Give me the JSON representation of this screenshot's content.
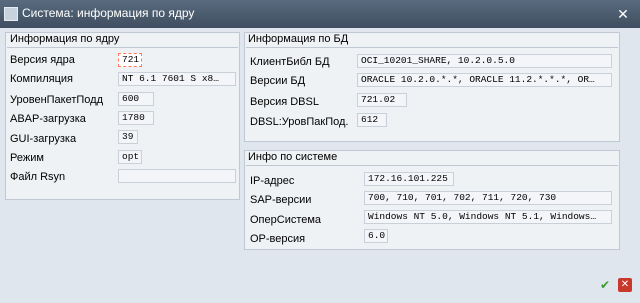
{
  "window": {
    "title": "Система: информация по ядру"
  },
  "kernel": {
    "title": "Информация по ядру",
    "rows": [
      {
        "label": "Версия ядра",
        "value": "721"
      },
      {
        "label": "Компиляция",
        "value": "NT 6.1 7601 S x8…"
      },
      {
        "label": "УровенПакетПодд",
        "value": "600"
      },
      {
        "label": "ABAP-загрузка",
        "value": "1780"
      },
      {
        "label": "GUI-загрузка",
        "value": "39"
      },
      {
        "label": "Режим",
        "value": "opt"
      },
      {
        "label": "Файл Rsyn",
        "value": ""
      }
    ]
  },
  "db": {
    "title": "Информация по БД",
    "rows": [
      {
        "label": "КлиентБибл БД",
        "value": "OCI_10201_SHARE, 10.2.0.5.0"
      },
      {
        "label": "Версии БД",
        "value": "ORACLE 10.2.0.*.*, ORACLE 11.2.*.*.*, OR…"
      },
      {
        "label": "Версия DBSL",
        "value": "721.02"
      },
      {
        "label": "DBSL:УровПакПод.",
        "value": "612"
      }
    ]
  },
  "system": {
    "title": "Инфо по системе",
    "rows": [
      {
        "label": "IP-адрес",
        "value": "172.16.101.225"
      },
      {
        "label": "SAP-версии",
        "value": "700, 710, 701, 702, 711, 720, 730"
      },
      {
        "label": "ОперСистема",
        "value": "Windows NT 5.0, Windows NT 5.1, Windows…"
      },
      {
        "label": "OP-версия",
        "value": "6.0"
      }
    ]
  },
  "footer": {
    "confirm_icon": "check-icon",
    "cancel_icon": "cancel-icon",
    "colors": {
      "confirm": "#3d9a2e",
      "cancel": "#c8392b"
    }
  }
}
